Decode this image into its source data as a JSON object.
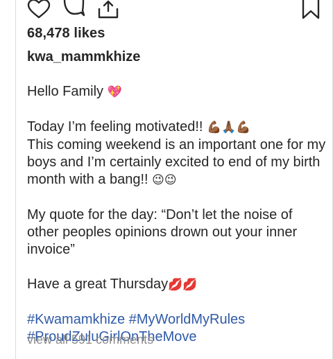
{
  "post": {
    "likes": "68,478 likes",
    "author": "kwa_mammkhize",
    "caption": {
      "line1": "Hello Family",
      "line1_emoji": "💖",
      "line2": "Today I’m feeling motivated!!",
      "line2_emoji": "💪🏾🙏🏾💪🏾",
      "line3": "This coming weekend is an important one for my boys and I’m certainly excited to end of my birth month with a bang!!",
      "line3_emoji": "😉😉",
      "line4": "My quote for the day: “Don’t let the noise of other peoples opinions drown out your inner invoice”",
      "line5": "Have a great Thursday",
      "line5_emoji": "💋💋",
      "hashtags": [
        "#Kwamamkhize",
        "#MyWorldMyRules",
        "#ProudZuluGirlOnTheMove"
      ]
    },
    "next_line": "view all 591 comments"
  },
  "icons": {
    "like": "heart-icon",
    "comment": "comment-icon",
    "share": "share-icon",
    "save": "bookmark-icon"
  }
}
